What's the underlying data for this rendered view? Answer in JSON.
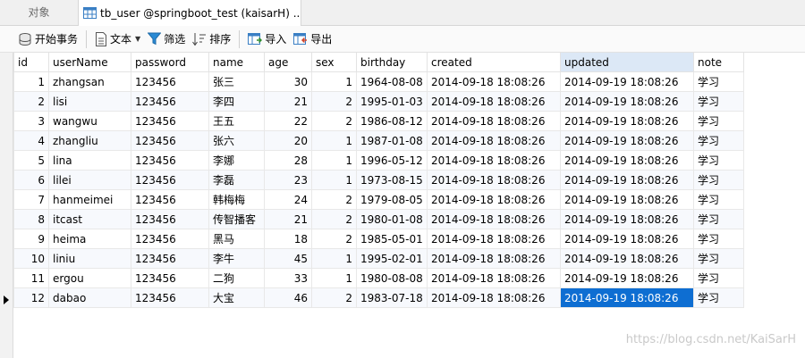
{
  "tabs": {
    "objects_label": "对象",
    "table_label": "tb_user @springboot_test (kaisarH) ..."
  },
  "toolbar": {
    "begin_transaction": "开始事务",
    "text": "文本",
    "filter": "筛选",
    "sort": "排序",
    "import": "导入",
    "export": "导出"
  },
  "grid": {
    "columns": [
      "id",
      "userName",
      "password",
      "name",
      "age",
      "sex",
      "birthday",
      "created",
      "updated",
      "note"
    ],
    "rows": [
      [
        "1",
        "zhangsan",
        "123456",
        "张三",
        "30",
        "1",
        "1964-08-08",
        "2014-09-18 18:08:26",
        "2014-09-19 18:08:26",
        "学习"
      ],
      [
        "2",
        "lisi",
        "123456",
        "李四",
        "21",
        "2",
        "1995-01-03",
        "2014-09-18 18:08:26",
        "2014-09-19 18:08:26",
        "学习"
      ],
      [
        "3",
        "wangwu",
        "123456",
        "王五",
        "22",
        "2",
        "1986-08-12",
        "2014-09-18 18:08:26",
        "2014-09-19 18:08:26",
        "学习"
      ],
      [
        "4",
        "zhangliu",
        "123456",
        "张六",
        "20",
        "1",
        "1987-01-08",
        "2014-09-18 18:08:26",
        "2014-09-19 18:08:26",
        "学习"
      ],
      [
        "5",
        "lina",
        "123456",
        "李娜",
        "28",
        "1",
        "1996-05-12",
        "2014-09-18 18:08:26",
        "2014-09-19 18:08:26",
        "学习"
      ],
      [
        "6",
        "lilei",
        "123456",
        "李磊",
        "23",
        "1",
        "1973-08-15",
        "2014-09-18 18:08:26",
        "2014-09-19 18:08:26",
        "学习"
      ],
      [
        "7",
        "hanmeimei",
        "123456",
        "韩梅梅",
        "24",
        "2",
        "1979-08-05",
        "2014-09-18 18:08:26",
        "2014-09-19 18:08:26",
        "学习"
      ],
      [
        "8",
        "itcast",
        "123456",
        "传智播客",
        "21",
        "2",
        "1980-01-08",
        "2014-09-18 18:08:26",
        "2014-09-19 18:08:26",
        "学习"
      ],
      [
        "9",
        "heima",
        "123456",
        "黑马",
        "18",
        "2",
        "1985-05-01",
        "2014-09-18 18:08:26",
        "2014-09-19 18:08:26",
        "学习"
      ],
      [
        "10",
        "liniu",
        "123456",
        "李牛",
        "45",
        "1",
        "1995-02-01",
        "2014-09-18 18:08:26",
        "2014-09-19 18:08:26",
        "学习"
      ],
      [
        "11",
        "ergou",
        "123456",
        "二狗",
        "33",
        "1",
        "1980-08-08",
        "2014-09-18 18:08:26",
        "2014-09-19 18:08:26",
        "学习"
      ],
      [
        "12",
        "dabao",
        "123456",
        "大宝",
        "46",
        "2",
        "1983-07-18",
        "2014-09-18 18:08:26",
        "2014-09-19 18:08:26",
        "学习"
      ]
    ],
    "selected_column": "updated",
    "current_row": 12
  },
  "watermark": "https://blog.csdn.net/KaiSarH",
  "colors": {
    "selection": "#0e6ed2",
    "header_selected": "#dce8f6",
    "filter_icon": "#2a8ad4"
  }
}
